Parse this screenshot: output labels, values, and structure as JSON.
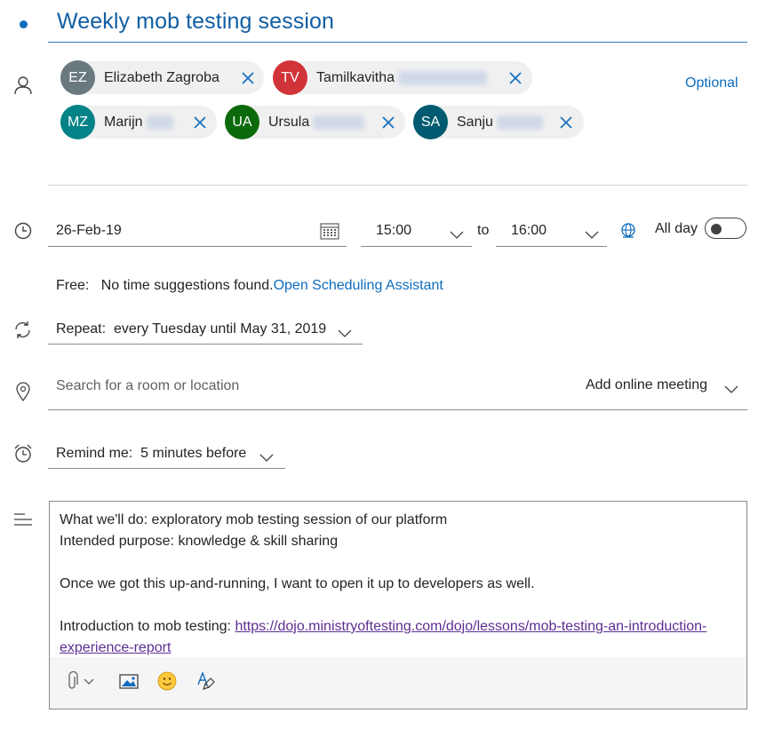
{
  "event": {
    "title": "Weekly mob testing session"
  },
  "attendees": {
    "optional_label": "Optional",
    "people": [
      {
        "initials": "EZ",
        "first": "Elizabeth Zagroba",
        "color": "#69797e"
      },
      {
        "initials": "TV",
        "first": "Tamilkavitha",
        "color": "#d13438"
      },
      {
        "initials": "MZ",
        "first": "Marijn",
        "color": "#038387"
      },
      {
        "initials": "UA",
        "first": "Ursula",
        "color": "#0b6a0b"
      },
      {
        "initials": "SA",
        "first": "Sanju",
        "color": "#005b70"
      }
    ]
  },
  "datetime": {
    "date": "26-Feb-19",
    "start_time": "15:00",
    "to_label": "to",
    "end_time": "16:00",
    "all_day_label": "All day",
    "all_day_on": false
  },
  "scheduling": {
    "free_label": "Free:",
    "message": "No time suggestions found.",
    "assistant_link": "Open Scheduling Assistant"
  },
  "repeat": {
    "label": "Repeat:",
    "value": "every Tuesday until May 31, 2019"
  },
  "location": {
    "placeholder": "Search for a room or location",
    "online_meeting": "Add online meeting"
  },
  "reminder": {
    "label": "Remind me:",
    "value": "5 minutes before"
  },
  "body": {
    "line1": "What we'll do: exploratory mob testing session of our platform",
    "line2": "Intended purpose: knowledge & skill sharing",
    "line3": "Once we got this up-and-running, I want to open it up to developers as well.",
    "intro_label": "Introduction to mob testing: ",
    "intro_link": "https://dojo.ministryoftesting.com/dojo/lessons/mob-testing-an-introduction-experience-report"
  },
  "icons": {
    "title": "title-dot",
    "attendees": "person-icon",
    "time": "clock-icon",
    "repeat": "repeat-icon",
    "location": "location-pin-icon",
    "reminder": "alarm-clock-icon",
    "body": "text-lines-icon",
    "attach": "paperclip-icon",
    "image": "image-icon",
    "emoji": "emoji-icon",
    "format": "format-painter-icon",
    "timezone": "globe-icon"
  },
  "colors": {
    "accent": "#0f6cbd",
    "link_visited": "#5c2e91"
  }
}
